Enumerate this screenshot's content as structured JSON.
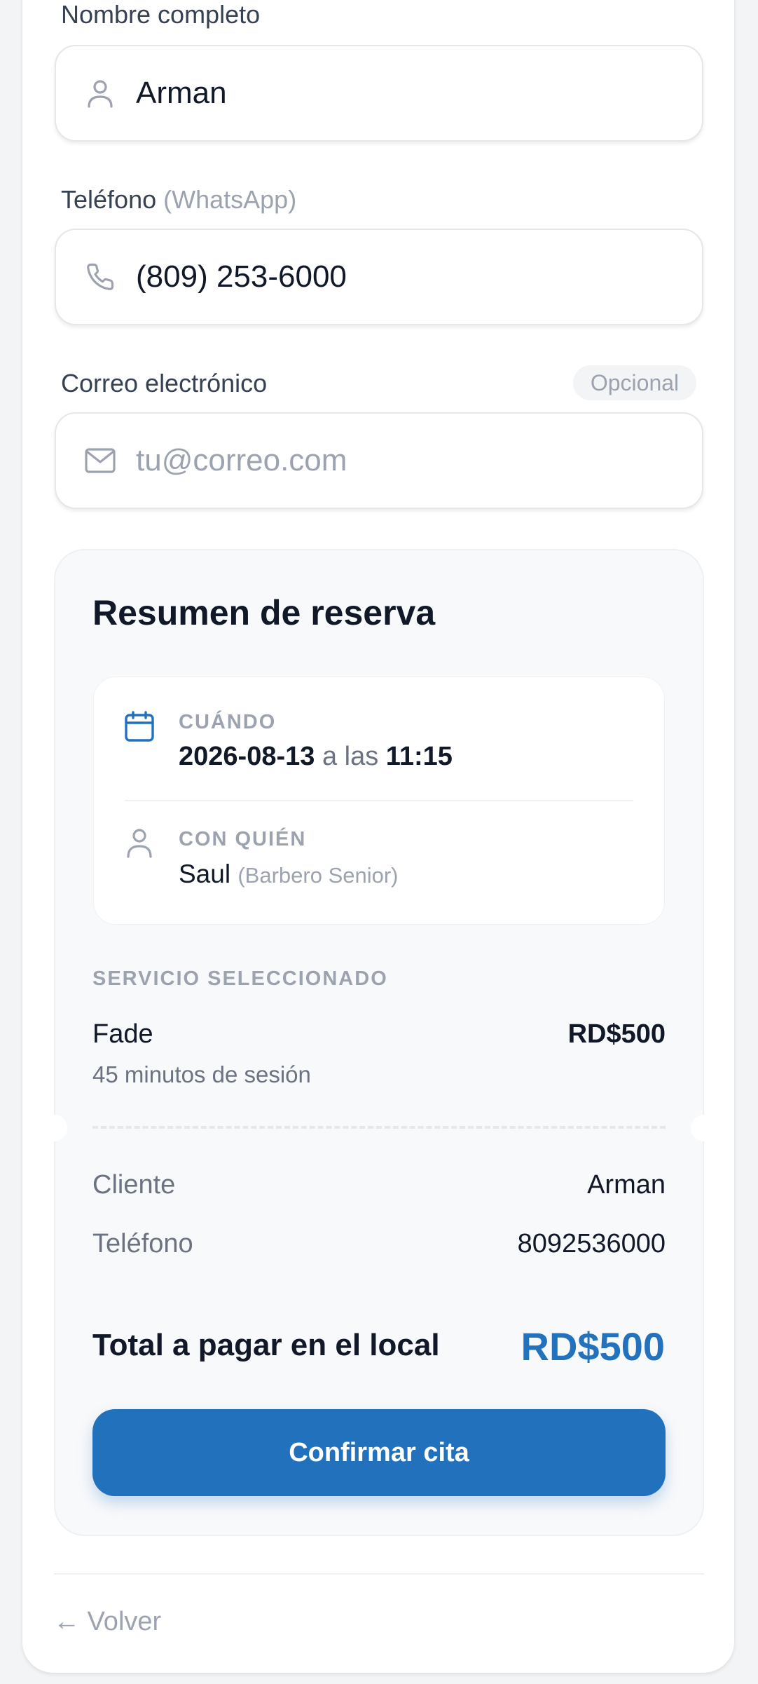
{
  "form": {
    "name_label": "Nombre completo",
    "name_value": "Arman",
    "phone_label": "Teléfono",
    "phone_label_hint": "(WhatsApp)",
    "phone_value": "(809) 253-6000",
    "email_label": "Correo electrónico",
    "email_badge": "Opcional",
    "email_placeholder": "tu@correo.com",
    "email_value": ""
  },
  "summary": {
    "title": "Resumen de reserva",
    "when_label": "CUÁNDO",
    "date": "2026-08-13",
    "at_text": "a las",
    "time": "11:15",
    "with_label": "CON QUIÉN",
    "barber_name": "Saul",
    "barber_role": "(Barbero Senior)",
    "service_label": "SERVICIO SELECCIONADO",
    "service_name": "Fade",
    "service_price": "RD$500",
    "service_duration": "45 minutos de sesión",
    "client_label": "Cliente",
    "client_value": "Arman",
    "phone_label": "Teléfono",
    "phone_value": "8092536000",
    "total_label": "Total a pagar en el local",
    "total_value": "RD$500",
    "confirm_label": "Confirmar cita"
  },
  "footer": {
    "back_label": "← Volver"
  },
  "colors": {
    "accent": "#2171bd",
    "muted": "#9ca3af"
  },
  "icons": {
    "name_field": "user-icon",
    "phone_field": "phone-icon",
    "email_field": "mail-icon",
    "when": "calendar-icon",
    "with": "user-icon"
  }
}
